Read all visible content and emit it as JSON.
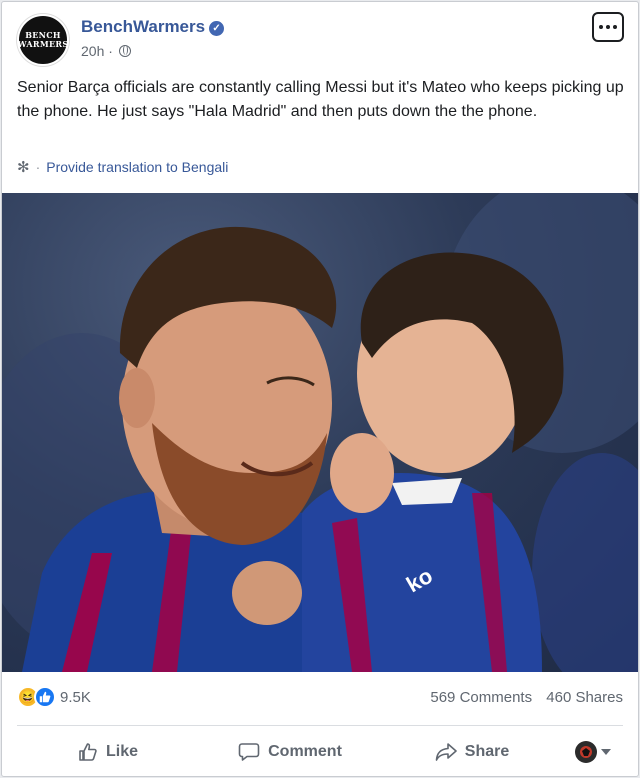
{
  "post": {
    "page_name": "BenchWarmers",
    "avatar_text_line1": "BENCH",
    "avatar_text_line2": "WARMERS",
    "time": "20h",
    "time_separator": "·",
    "text": "Senior Barça officials are constantly calling Messi but it's Mateo who keeps picking up the phone. He just says \"Hala Madrid\" and then puts down the the phone.",
    "translate_separator": "·",
    "translate_label": "Provide translation to Bengali"
  },
  "icons": {
    "verified": "verified-badge-icon",
    "privacy": "globe-icon",
    "more": "more-options-icon",
    "translate": "gear-icon",
    "haha": "haha-reaction-icon",
    "like": "like-reaction-icon"
  },
  "stats": {
    "reactions_count": "9.5K",
    "comments": "569 Comments",
    "shares": "460 Shares"
  },
  "actions": {
    "like": "Like",
    "comment": "Comment",
    "share": "Share"
  },
  "colors": {
    "link": "#385898",
    "text": "#1c1e21",
    "secondary": "#606770",
    "like_blue": "#1877f2",
    "haha_yellow": "#f7b928",
    "barca_blue": "#1b3f95",
    "barca_red": "#a50044"
  }
}
